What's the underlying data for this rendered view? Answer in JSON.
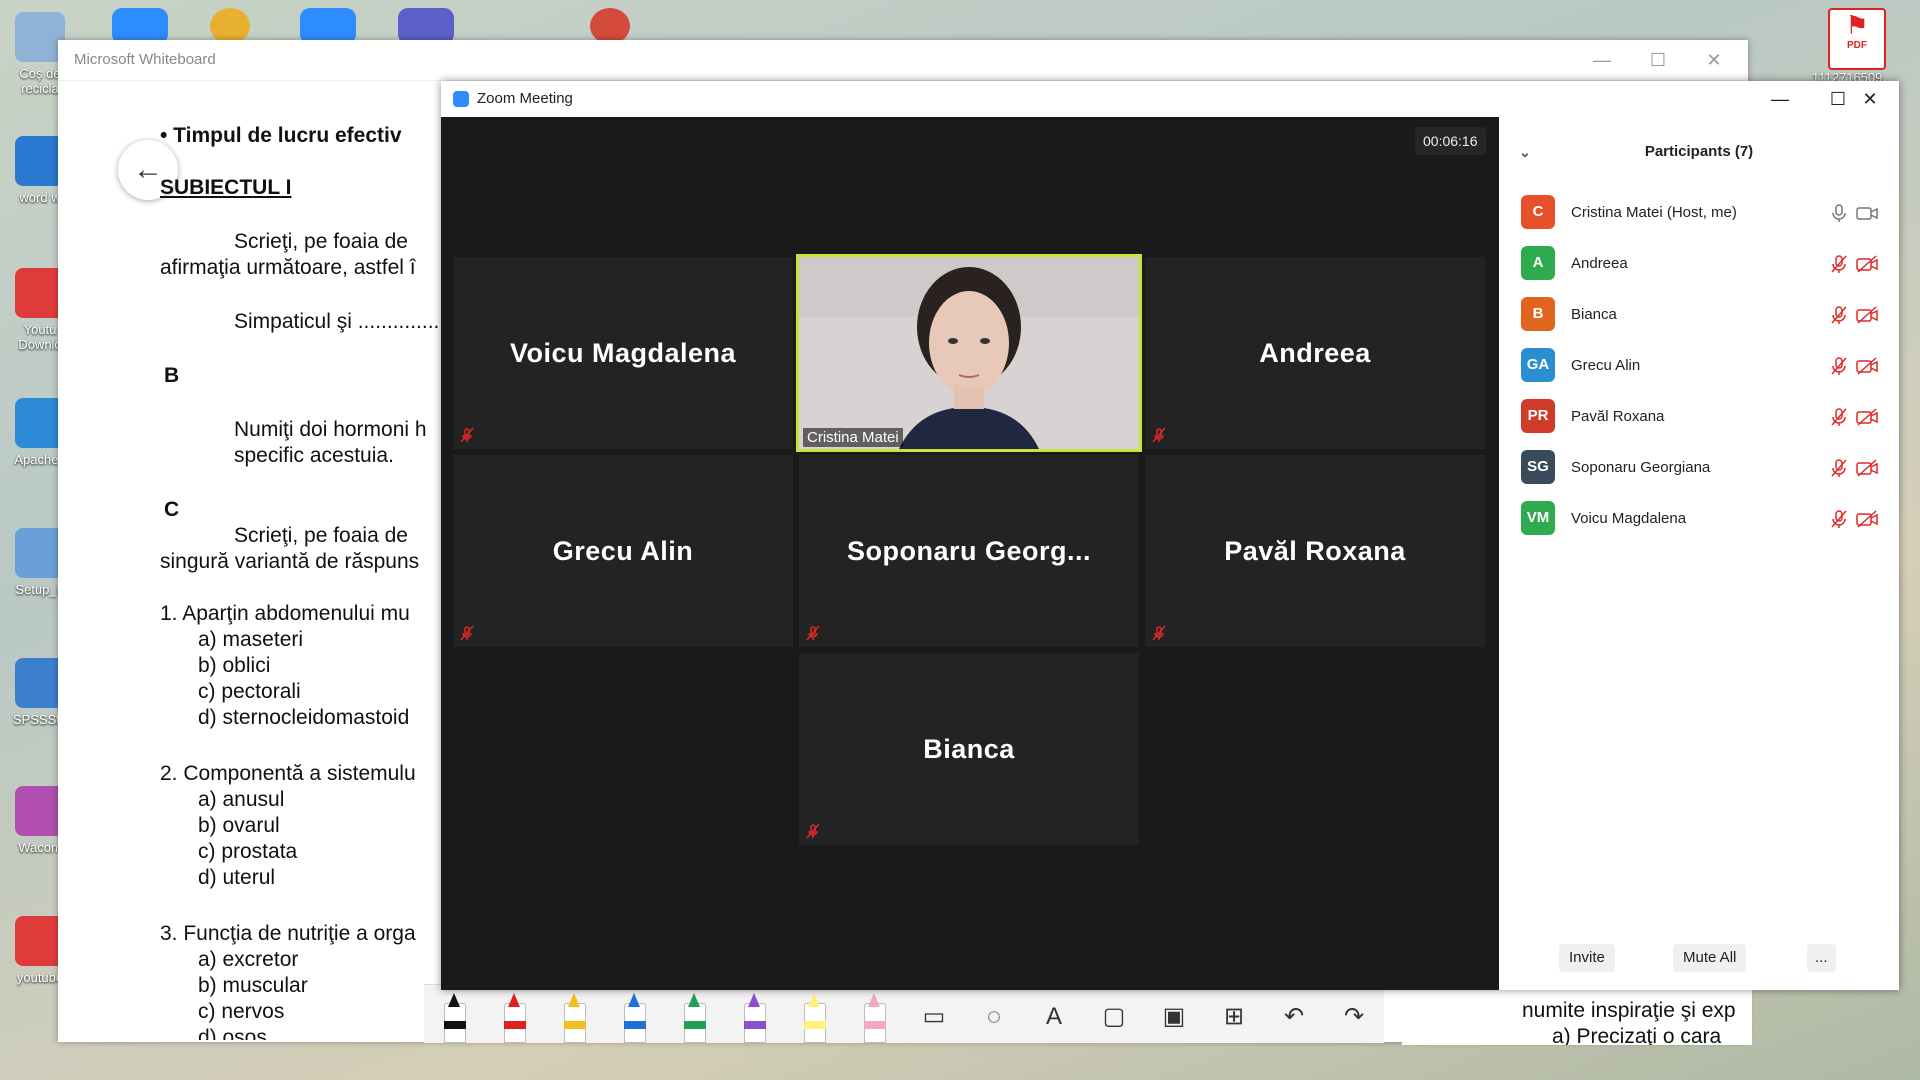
{
  "desktop": {
    "icons": [
      {
        "label": "Coş de recicla",
        "color": "#8fb3d6"
      },
      {
        "label": "word w",
        "color": "#2b78d0"
      },
      {
        "label": "Youtu Downlo",
        "color": "#e03b3b"
      },
      {
        "label": "Apache_",
        "color": "#2c8ad6"
      },
      {
        "label": "Setup_F",
        "color": "#6aa0d8"
      },
      {
        "label": "SPSSSta",
        "color": "#3b7fce"
      },
      {
        "label": "Wacom",
        "color": "#b04fb0"
      },
      {
        "label": "youtube",
        "color": "#e03b3b"
      }
    ],
    "pdf_label": "PDF",
    "pdf_caption": "1112716509"
  },
  "whiteboard": {
    "title": "Microsoft Whiteboard",
    "controls": {
      "minimize": "—",
      "maximize": "☐",
      "close": "✕"
    },
    "doc_lines": [
      "•  Timpul de lucru efectiv",
      "SUBIECTUL I",
      "Scrieţi, pe foaia de",
      "afirmaţia următoare, astfel î",
      "Simpaticul şi ..............",
      "B",
      "Numiţi doi hormoni h",
      "specific acestuia.",
      "C",
      "Scrieţi, pe foaia de",
      "singură variantă de răspuns",
      "1.  Aparţin abdomenului mu",
      "a)   maseteri",
      "b)   oblici",
      "c)   pectorali",
      "d)   sternocleidomastoid",
      "2.  Componentă a sistemulu",
      "a)   anusul",
      "b)   ovarul",
      "c)   prostata",
      "d)   uterul",
      "3.  Funcţia de nutriţie a orga",
      "a)   excretor",
      "b)   muscular",
      "c)   nervos",
      "d)   osos"
    ],
    "doc_right_lines": [
      "numite inspiraţie şi exp",
      "a)   Precizaţi o cara"
    ],
    "toolbar": {
      "pens": [
        {
          "name": "black-pen",
          "color": "#111111"
        },
        {
          "name": "red-pen",
          "color": "#e02020"
        },
        {
          "name": "yellow-pen",
          "color": "#f0c020"
        },
        {
          "name": "blue-pen",
          "color": "#1e6fd8"
        },
        {
          "name": "green-pen",
          "color": "#20a050"
        },
        {
          "name": "purple-pen",
          "color": "#8a4fd0"
        },
        {
          "name": "highlighter",
          "color": "#fff27a"
        },
        {
          "name": "eraser",
          "color": "#f3a8c0"
        }
      ],
      "tools": [
        "ruler-icon",
        "lasso-icon",
        "text-icon",
        "note-icon",
        "image-icon",
        "add-icon",
        "undo-icon",
        "redo-icon"
      ]
    }
  },
  "zoom": {
    "title": "Zoom Meeting",
    "controls": {
      "minimize": "—",
      "maximize": "☐",
      "close": "✕"
    },
    "timer": "00:06:16",
    "tiles": [
      {
        "name": "Voicu Magdalena",
        "muted": true
      },
      {
        "name": "Cristina Matei",
        "muted": false,
        "video": true
      },
      {
        "name": "Andreea",
        "muted": true
      },
      {
        "name": "Grecu Alin",
        "muted": true
      },
      {
        "name": "Soponaru  Georg...",
        "muted": true
      },
      {
        "name": "Pavăl Roxana",
        "muted": true
      },
      {
        "name": "Bianca",
        "muted": true
      }
    ],
    "participants": {
      "header": "Participants (7)",
      "list": [
        {
          "initials": "C",
          "name": "Cristina Matei (Host, me)",
          "color": "#e8502a",
          "muted": false
        },
        {
          "initials": "A",
          "name": "Andreea",
          "color": "#2eaa4f",
          "muted": true
        },
        {
          "initials": "B",
          "name": "Bianca",
          "color": "#e0651e",
          "muted": true
        },
        {
          "initials": "GA",
          "name": "Grecu Alin",
          "color": "#2a8fd0",
          "muted": true
        },
        {
          "initials": "PR",
          "name": "Pavăl Roxana",
          "color": "#d03a2a",
          "muted": true
        },
        {
          "initials": "SG",
          "name": "Soponaru Georgiana",
          "color": "#3a4a5a",
          "muted": true
        },
        {
          "initials": "VM",
          "name": "Voicu Magdalena",
          "color": "#2eaa4f",
          "muted": true
        }
      ],
      "footer": {
        "invite": "Invite",
        "mute_all": "Mute All",
        "more": "..."
      }
    }
  }
}
